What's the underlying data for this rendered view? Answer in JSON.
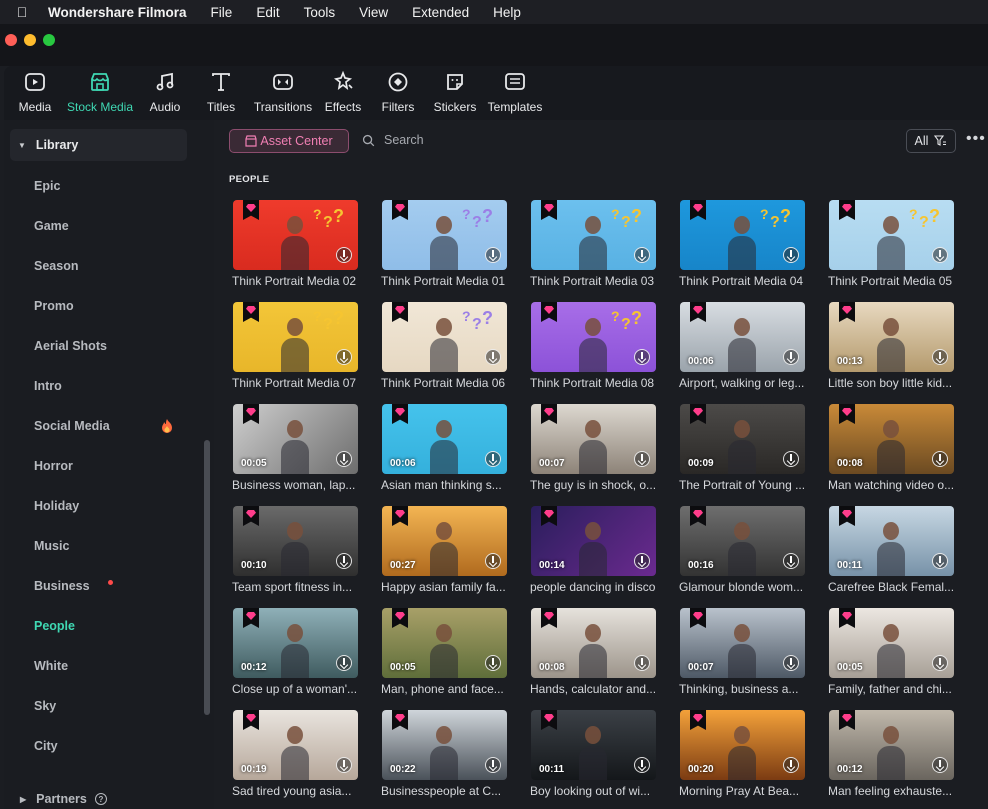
{
  "menubar": {
    "app_name": "Wondershare Filmora",
    "items": [
      "File",
      "Edit",
      "Tools",
      "View",
      "Extended",
      "Help"
    ]
  },
  "toolbar": {
    "tabs": [
      {
        "label": "Media",
        "icon": "media-icon"
      },
      {
        "label": "Stock Media",
        "icon": "stock-media-icon",
        "active": true
      },
      {
        "label": "Audio",
        "icon": "audio-icon"
      },
      {
        "label": "Titles",
        "icon": "titles-icon"
      },
      {
        "label": "Transitions",
        "icon": "transitions-icon"
      },
      {
        "label": "Effects",
        "icon": "effects-icon"
      },
      {
        "label": "Filters",
        "icon": "filters-icon"
      },
      {
        "label": "Stickers",
        "icon": "stickers-icon"
      },
      {
        "label": "Templates",
        "icon": "templates-icon"
      }
    ]
  },
  "sidebar": {
    "library_label": "Library",
    "categories": [
      "Epic",
      "Game",
      "Season",
      "Promo",
      "Aerial Shots",
      "Intro",
      "Social Media",
      "Horror",
      "Holiday",
      "Music",
      "Business",
      "People",
      "White",
      "Sky",
      "City"
    ],
    "active_category": "People",
    "partners_label": "Partners"
  },
  "main": {
    "asset_center_label": "Asset Center",
    "search_placeholder": "Search",
    "filter_label": "All",
    "section_title": "PEOPLE",
    "items": [
      {
        "title": "Think Portrait Media 02",
        "duration": ""
      },
      {
        "title": "Think Portrait Media 01",
        "duration": ""
      },
      {
        "title": "Think Portrait Media 03",
        "duration": ""
      },
      {
        "title": "Think Portrait Media 04",
        "duration": ""
      },
      {
        "title": "Think Portrait Media 05",
        "duration": ""
      },
      {
        "title": "Think Portrait Media 07",
        "duration": ""
      },
      {
        "title": "Think Portrait Media 06",
        "duration": ""
      },
      {
        "title": "Think Portrait Media 08",
        "duration": ""
      },
      {
        "title": "Airport, walking or leg...",
        "duration": "00:06"
      },
      {
        "title": "Little son boy little kid...",
        "duration": "00:13"
      },
      {
        "title": "Business woman, lap...",
        "duration": "00:05"
      },
      {
        "title": "Asian man thinking s...",
        "duration": "00:06"
      },
      {
        "title": "The guy is in shock, o...",
        "duration": "00:07"
      },
      {
        "title": "The Portrait of Young ...",
        "duration": "00:09"
      },
      {
        "title": "Man watching video o...",
        "duration": "00:08"
      },
      {
        "title": "Team sport fitness in...",
        "duration": "00:10"
      },
      {
        "title": "Happy asian family fa...",
        "duration": "00:27"
      },
      {
        "title": "people dancing in disco",
        "duration": "00:14"
      },
      {
        "title": "Glamour blonde wom...",
        "duration": "00:16"
      },
      {
        "title": "Carefree Black Femal...",
        "duration": "00:11"
      },
      {
        "title": "Close up of a woman'...",
        "duration": "00:12"
      },
      {
        "title": "Man, phone and face...",
        "duration": "00:05"
      },
      {
        "title": "Hands, calculator and...",
        "duration": "00:08"
      },
      {
        "title": "Thinking, business a...",
        "duration": "00:07"
      },
      {
        "title": "Family, father and chi...",
        "duration": "00:05"
      },
      {
        "title": "Sad tired young asia...",
        "duration": "00:19"
      },
      {
        "title": "Businesspeople at C...",
        "duration": "00:22"
      },
      {
        "title": "Boy looking out of wi...",
        "duration": "00:11"
      },
      {
        "title": "Morning Pray At Bea...",
        "duration": "00:20"
      },
      {
        "title": "Man feeling exhauste...",
        "duration": "00:12"
      }
    ]
  }
}
